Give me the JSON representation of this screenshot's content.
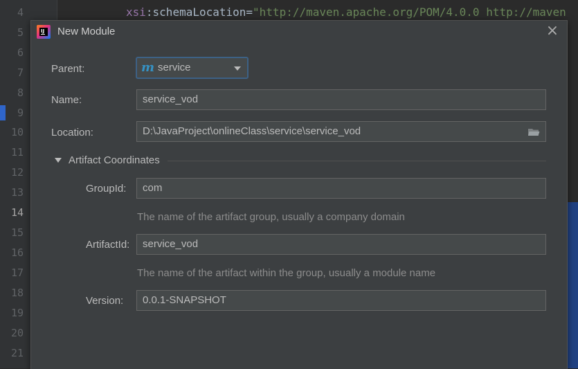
{
  "editor": {
    "line_numbers": [
      "4",
      "5",
      "6",
      "7",
      "8",
      "9",
      "10",
      "11",
      "12",
      "13",
      "14",
      "15",
      "16",
      "17",
      "18",
      "19",
      "20",
      "21"
    ],
    "current_line": "14",
    "code_line": {
      "attr_prefix": "xsi",
      "attr_rest": ":schemaLocation",
      "equals": "=",
      "value": "\"http://maven.apache.org/POM/4.0.0 http://maven"
    }
  },
  "dialog": {
    "title": "New Module",
    "close_glyph": "×",
    "parent": {
      "label": "Parent:",
      "value": "service",
      "icon_glyph": "m"
    },
    "name": {
      "label": "Name:",
      "value": "service_vod"
    },
    "location": {
      "label": "Location:",
      "value": "D:\\JavaProject\\onlineClass\\service\\service_vod"
    },
    "artifact_section": {
      "title": "Artifact Coordinates",
      "group_id": {
        "label": "GroupId:",
        "value": "com",
        "hint": "The name of the artifact group, usually a company domain"
      },
      "artifact_id": {
        "label": "ArtifactId:",
        "value": "service_vod",
        "hint": "The name of the artifact within the group, usually a module name"
      },
      "version": {
        "label": "Version:",
        "value": "0.0.1-SNAPSHOT"
      }
    }
  },
  "colors": {
    "editor_bg": "#2b2b2b",
    "dialog_bg": "#3c3f41",
    "field_bg": "#45494a",
    "focus_border": "#3d6185",
    "maven_blue": "#3592c4"
  }
}
